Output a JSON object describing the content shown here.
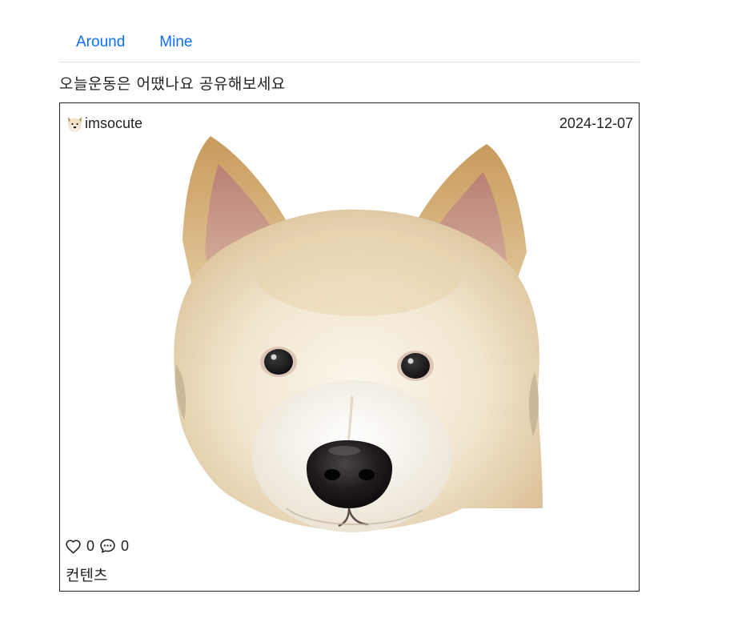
{
  "tabs": [
    {
      "label": "Around"
    },
    {
      "label": "Mine"
    }
  ],
  "headline": "오늘운동은 어땠나요 공유해보세요",
  "post": {
    "author": "imsocute",
    "date": "2024-12-07",
    "likes": "0",
    "comments": "0",
    "content": "컨텐츠",
    "image_subject": "white-dog-face-photo",
    "avatar_icon": "dog-avatar-icon"
  },
  "colors": {
    "tab_link": "#0d6efd",
    "text": "#222222",
    "tab_border": "#dee2e6",
    "card_border": "#222222"
  }
}
